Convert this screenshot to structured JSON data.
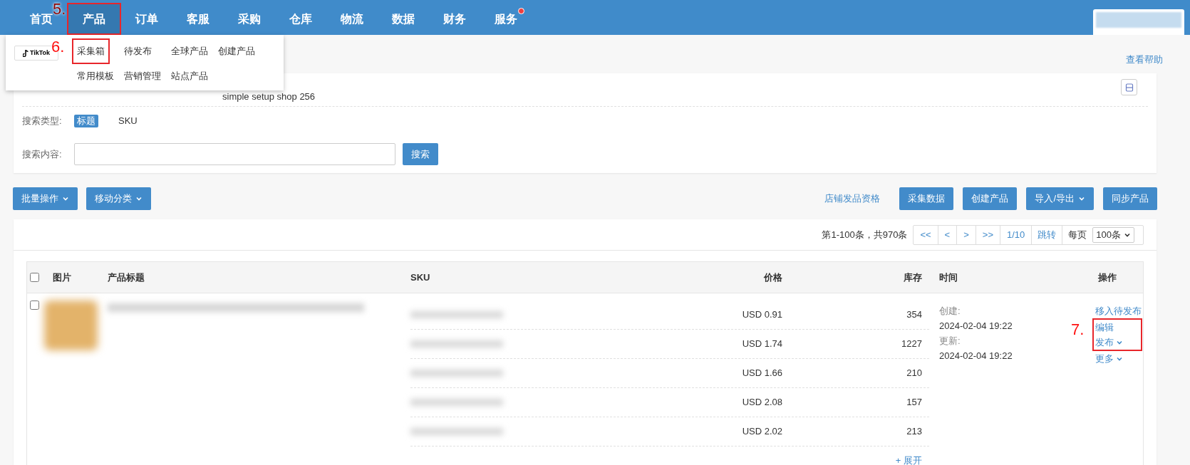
{
  "nav": {
    "items": [
      {
        "label": "首页",
        "selected": false,
        "dot": false
      },
      {
        "label": "产品",
        "selected": true,
        "dot": false,
        "annotation": "5."
      },
      {
        "label": "订单",
        "selected": false,
        "dot": false
      },
      {
        "label": "客服",
        "selected": false,
        "dot": false
      },
      {
        "label": "采购",
        "selected": false,
        "dot": false
      },
      {
        "label": "仓库",
        "selected": false,
        "dot": false
      },
      {
        "label": "物流",
        "selected": false,
        "dot": false
      },
      {
        "label": "数据",
        "selected": false,
        "dot": false
      },
      {
        "label": "财务",
        "selected": false,
        "dot": false
      },
      {
        "label": "服务",
        "selected": false,
        "dot": true
      }
    ]
  },
  "menu": {
    "logo_text": "TikTok",
    "items": [
      {
        "label": "采集箱",
        "annotation": "6."
      },
      {
        "label": "待发布"
      },
      {
        "label": "全球产品"
      },
      {
        "label": "创建产品"
      },
      {
        "label": "常用模板"
      },
      {
        "label": "营销管理"
      },
      {
        "label": "站点产品"
      }
    ]
  },
  "help_link": "查看帮助",
  "filters": {
    "shop_row": {
      "values": [
        "simple setup shop 256"
      ]
    },
    "search_type": {
      "label": "搜索类型:",
      "options": [
        {
          "label": "标题",
          "selected": true
        },
        {
          "label": "SKU",
          "selected": false
        }
      ]
    },
    "search_content": {
      "label": "搜索内容:",
      "button": "搜索"
    }
  },
  "toolbar": {
    "left": [
      {
        "label": "批量操作",
        "dropdown": true
      },
      {
        "label": "移动分类",
        "dropdown": true
      }
    ],
    "link": "店铺发品资格",
    "right": [
      {
        "label": "采集数据",
        "dropdown": false
      },
      {
        "label": "创建产品",
        "dropdown": false
      },
      {
        "label": "导入/导出",
        "dropdown": true
      },
      {
        "label": "同步产品",
        "dropdown": false
      }
    ]
  },
  "pagination": {
    "summary": "第1-100条，共970条",
    "pages": [
      "<<",
      "<",
      ">",
      ">>",
      "1/10"
    ],
    "jump": "跳转",
    "per_page_label": "每页",
    "per_page": "100条"
  },
  "table": {
    "columns": [
      "图片",
      "产品标题",
      "SKU",
      "价格",
      "库存",
      "时间",
      "操作"
    ],
    "all_checked": false,
    "rows": [
      {
        "checked": false,
        "variants": [
          {
            "price": "USD 0.91",
            "stock": "354"
          },
          {
            "price": "USD 1.74",
            "stock": "1227"
          },
          {
            "price": "USD 1.66",
            "stock": "210"
          },
          {
            "price": "USD 2.08",
            "stock": "157"
          },
          {
            "price": "USD 2.02",
            "stock": "213"
          }
        ],
        "expand": "+ 展开",
        "time": {
          "created_label": "创建:",
          "created": "2024-02-04 19:22",
          "updated_label": "更新:",
          "updated": "2024-02-04 19:22"
        },
        "annotation": "7.",
        "actions": [
          {
            "label": "移入待发布",
            "dropdown": false,
            "in_annotation": false
          },
          {
            "label": "编辑",
            "dropdown": false,
            "in_annotation": true
          },
          {
            "label": "发布",
            "dropdown": true,
            "in_annotation": true
          },
          {
            "label": "更多",
            "dropdown": true,
            "in_annotation": false
          }
        ]
      }
    ]
  }
}
